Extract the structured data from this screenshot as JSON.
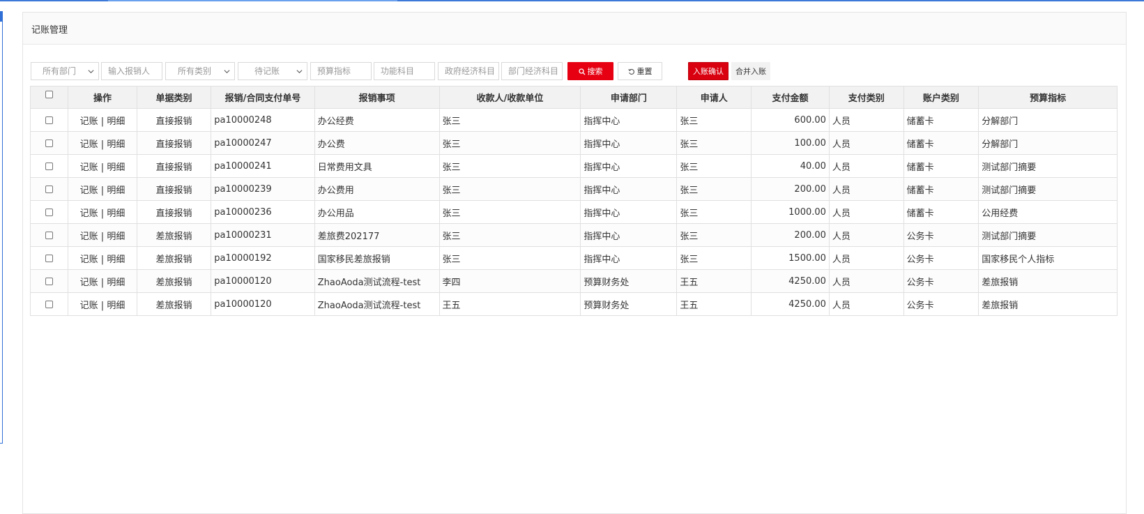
{
  "panel": {
    "title": "记账管理"
  },
  "filters": {
    "department": "所有部门",
    "reimburser_placeholder": "输入报销人",
    "category": "所有类别",
    "status": "待记账",
    "budget_indicator_placeholder": "预算指标",
    "function_subject_placeholder": "功能科目",
    "gov_econ_subject_placeholder": "政府经济科目",
    "dept_econ_subject_placeholder": "部门经济科目"
  },
  "buttons": {
    "search": "搜索",
    "reset": "重置",
    "confirm_entry": "入账确认",
    "merge_entry": "合并入账"
  },
  "colors": {
    "accent_red": "#e60012",
    "frame_blue": "#2f6fd6"
  },
  "table": {
    "columns": [
      "",
      "操作",
      "单据类别",
      "报销/合同支付单号",
      "报销事项",
      "收款人/收款单位",
      "申请部门",
      "申请人",
      "支付金额",
      "支付类别",
      "账户类别",
      "预算指标"
    ],
    "rows": [
      [
        "记账 | 明细",
        "直接报销",
        "pa10000248",
        "办公经费",
        "张三",
        "指挥中心",
        "张三",
        "600.00",
        "人员",
        "储蓄卡",
        "分解部门"
      ],
      [
        "记账 | 明细",
        "直接报销",
        "pa10000247",
        "办公费",
        "张三",
        "指挥中心",
        "张三",
        "100.00",
        "人员",
        "储蓄卡",
        "分解部门"
      ],
      [
        "记账 | 明细",
        "直接报销",
        "pa10000241",
        "日常费用文具",
        "张三",
        "指挥中心",
        "张三",
        "40.00",
        "人员",
        "储蓄卡",
        "测试部门摘要"
      ],
      [
        "记账 | 明细",
        "直接报销",
        "pa10000239",
        "办公费用",
        "张三",
        "指挥中心",
        "张三",
        "200.00",
        "人员",
        "储蓄卡",
        "测试部门摘要"
      ],
      [
        "记账 | 明细",
        "直接报销",
        "pa10000236",
        "办公用品",
        "张三",
        "指挥中心",
        "张三",
        "1000.00",
        "人员",
        "储蓄卡",
        "公用经费"
      ],
      [
        "记账 | 明细",
        "差旅报销",
        "pa10000231",
        "差旅费202177",
        "张三",
        "指挥中心",
        "张三",
        "200.00",
        "人员",
        "公务卡",
        "测试部门摘要"
      ],
      [
        "记账 | 明细",
        "差旅报销",
        "pa10000192",
        "国家移民差旅报销",
        "张三",
        "指挥中心",
        "张三",
        "1500.00",
        "人员",
        "公务卡",
        "国家移民个人指标"
      ],
      [
        "记账 | 明细",
        "差旅报销",
        "pa10000120",
        "ZhaoAoda测试流程-test",
        "李四",
        "预算财务处",
        "王五",
        "4250.00",
        "人员",
        "公务卡",
        "差旅报销"
      ],
      [
        "记账 | 明细",
        "差旅报销",
        "pa10000120",
        "ZhaoAoda测试流程-test",
        "王五",
        "预算财务处",
        "王五",
        "4250.00",
        "人员",
        "公务卡",
        "差旅报销"
      ]
    ]
  }
}
